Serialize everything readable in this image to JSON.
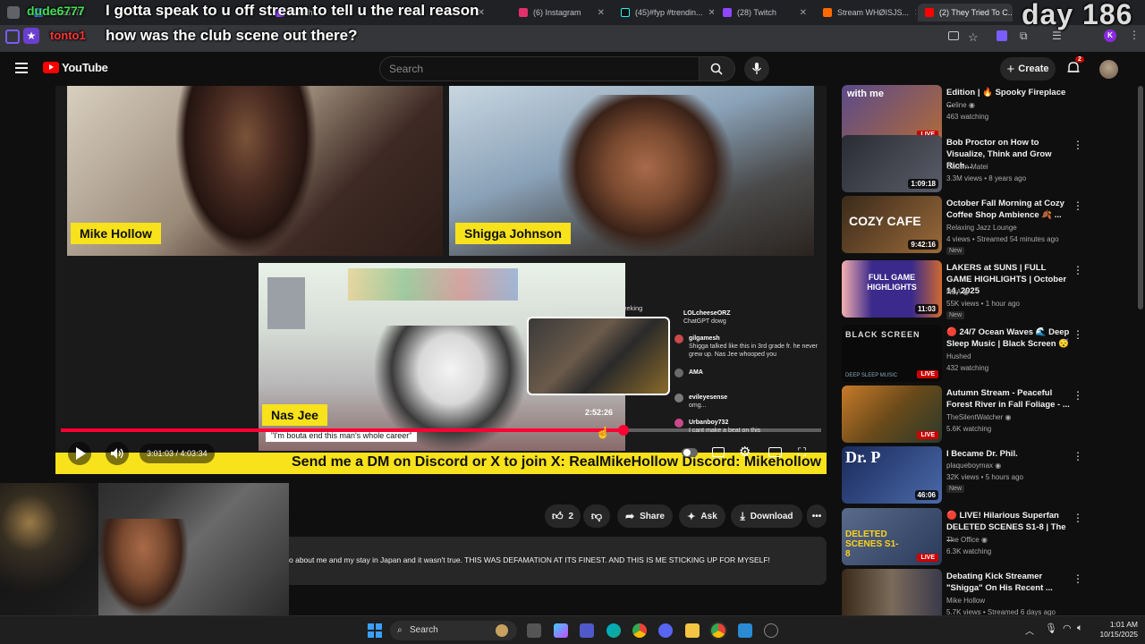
{
  "browser": {
    "tabs": [
      {
        "label": "dude6777",
        "color": "#4285f4"
      },
      {
        "label": "Twitch",
        "color": "#9146ff"
      },
      {
        "label": "(6) Instagram",
        "color": "#e1306c"
      },
      {
        "label": "(45)#fyp #trendin...",
        "color": "#111111"
      },
      {
        "label": "(28) Twitch",
        "color": "#9146ff"
      },
      {
        "label": "Stream WHØISJS...",
        "color": "#ff6a00"
      },
      {
        "label": "(2) They Tried To C...",
        "color": "#ff0000"
      }
    ],
    "tab_prefix": "S"
  },
  "overlay": {
    "username": "dude6777",
    "message1": "I gotta speak to u off stream to tell u the real reason",
    "username2": "tonto1",
    "message2": "how was the club scene out there?",
    "day_counter": "day 186"
  },
  "youtube": {
    "logo": "YouTube",
    "search_placeholder": "Search",
    "create_label": "Create",
    "notif_count": "2"
  },
  "player": {
    "cam1_name": "Mike Hollow",
    "cam2_name": "Shigga Johnson",
    "cam3_name": "Nas Jee",
    "caption": "\"I'm bouta end this man's whole career\"",
    "hover_time": "2:52:26",
    "seek_hint": "Pull up for precise seeking",
    "time_current": "3:01:03",
    "time_total": "4:03:34",
    "time_sep": " / ",
    "progress": 0.74,
    "ticker": "Send me a DM on Discord or X to join X: RealMikeHollow Discord: Mikehollow",
    "chat": [
      {
        "user": "LOLcheeseORZ",
        "text": "ChatGPT dowg"
      },
      {
        "user": "gilgamesh",
        "text": "Shigga talked like this in 3rd grade fr. he never grew up. Nas Jee whooped you"
      },
      {
        "user": "AMA",
        "text": ""
      },
      {
        "user": "evileyesense",
        "text": "omg..."
      },
      {
        "user": "Urbanboy732",
        "text": "I cant make a beat on this"
      }
    ]
  },
  "actions": {
    "like_count": "2",
    "share": "Share",
    "ask": "Ask",
    "download": "Download"
  },
  "description": "o about me and my stay in Japan and it wasn't true. THIS WAS DEFAMATION AT ITS FINEST. AND THIS IS ME STICKING UP FOR MYSELF!",
  "recommendations": [
    {
      "title": "Edition | 🔥 Spooky Fireplace ...",
      "channel": "Celine",
      "meta": "463 watching",
      "badge": "LIVE",
      "verified": true,
      "thumb": "#6b4b7a"
    },
    {
      "title": "Bob Proctor on How to Visualize, Think and Grow Rich...",
      "channel": "Catalin Matei",
      "meta": "3.3M views • 8 years ago",
      "badge": "1:09:18",
      "thumb": "#3d3f48"
    },
    {
      "title": "October Fall Morning at Cozy Coffee Shop Ambience 🍂 ...",
      "channel": "Relaxing Jazz Lounge",
      "meta": "4 views • Streamed 54 minutes ago",
      "badge": "9:42:16",
      "new": true,
      "thumb": "#6a4a2a"
    },
    {
      "title": "LAKERS at SUNS | FULL GAME HIGHLIGHTS | October 14, 2025",
      "channel": "NBA",
      "meta": "55K views • 1 hour ago",
      "badge": "11:03",
      "new": true,
      "verified": true,
      "thumb": "#3b2a6b"
    },
    {
      "title": "🔴 24/7 Ocean Waves 🌊 Deep Sleep Music | Black Screen 😴",
      "channel": "Hushed",
      "meta": "432 watching",
      "badge": "LIVE",
      "thumb": "#111111"
    },
    {
      "title": "Autumn Stream - Peaceful Forest River in Fall Foliage - ...",
      "channel": "TheSilentWatcher",
      "meta": "5.6K watching",
      "badge": "LIVE",
      "verified": true,
      "thumb": "#8a5a1a"
    },
    {
      "title": "I Became Dr. Phil.",
      "channel": "plaqueboymax",
      "meta": "32K views • 5 hours ago",
      "badge": "46:06",
      "new": true,
      "verified": true,
      "thumb": "#2a3a6a"
    },
    {
      "title": "🔴 LIVE! Hilarious Superfan DELETED SCENES S1-8 | The ...",
      "channel": "The Office",
      "meta": "6.3K watching",
      "badge": "LIVE",
      "verified": true,
      "thumb": "#4a5a7a"
    },
    {
      "title": "Debating Kick Streamer \"Shigga\" On His Recent ...",
      "channel": "Mike Hollow",
      "meta": "5.7K views • Streamed 6 days ago",
      "badge": "",
      "thumb": "#5a4a3a"
    }
  ],
  "thumb_text": {
    "with_me": "with me",
    "cozy": "COZY CAFE",
    "full_game": "FULL GAME HIGHLIGHTS",
    "black_screen": "BLACK SCREEN",
    "deep_sleep": "DEEP SLEEP MUSIC",
    "drp": "Dr. P",
    "deleted": "DELETED SCENES S1-8"
  },
  "taskbar": {
    "search": "Search",
    "time": "1:01 AM",
    "date": "10/15/2025"
  },
  "colors": {
    "youtube_red": "#ff0000",
    "ticker_yellow": "#f7e21c",
    "progress_red": "#ff0033"
  }
}
